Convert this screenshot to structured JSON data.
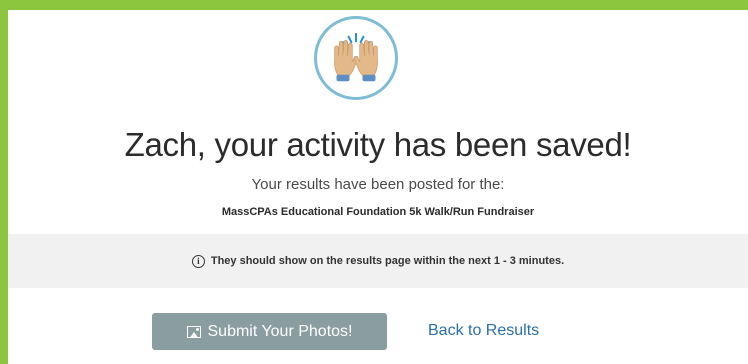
{
  "icon": "raised-hands-celebration-icon",
  "headline": "Zach, your activity has been saved!",
  "subtext": "Your results have been posted for the:",
  "event_name": "MassCPAs Educational Foundation 5k Walk/Run Fundraiser",
  "notice": {
    "icon": "info-icon",
    "text": "They should show on the results page within the next 1 - 3 minutes."
  },
  "actions": {
    "submit_photos": {
      "icon": "image-icon",
      "label": "Submit Your Photos!"
    },
    "back_to_results": "Back to Results"
  },
  "colors": {
    "page_background": "#8cc63f",
    "circle_border": "#7fbcd6",
    "photo_button": "#8a9da0",
    "link": "#2a6fa8",
    "notice_background": "#f1f1f1"
  }
}
